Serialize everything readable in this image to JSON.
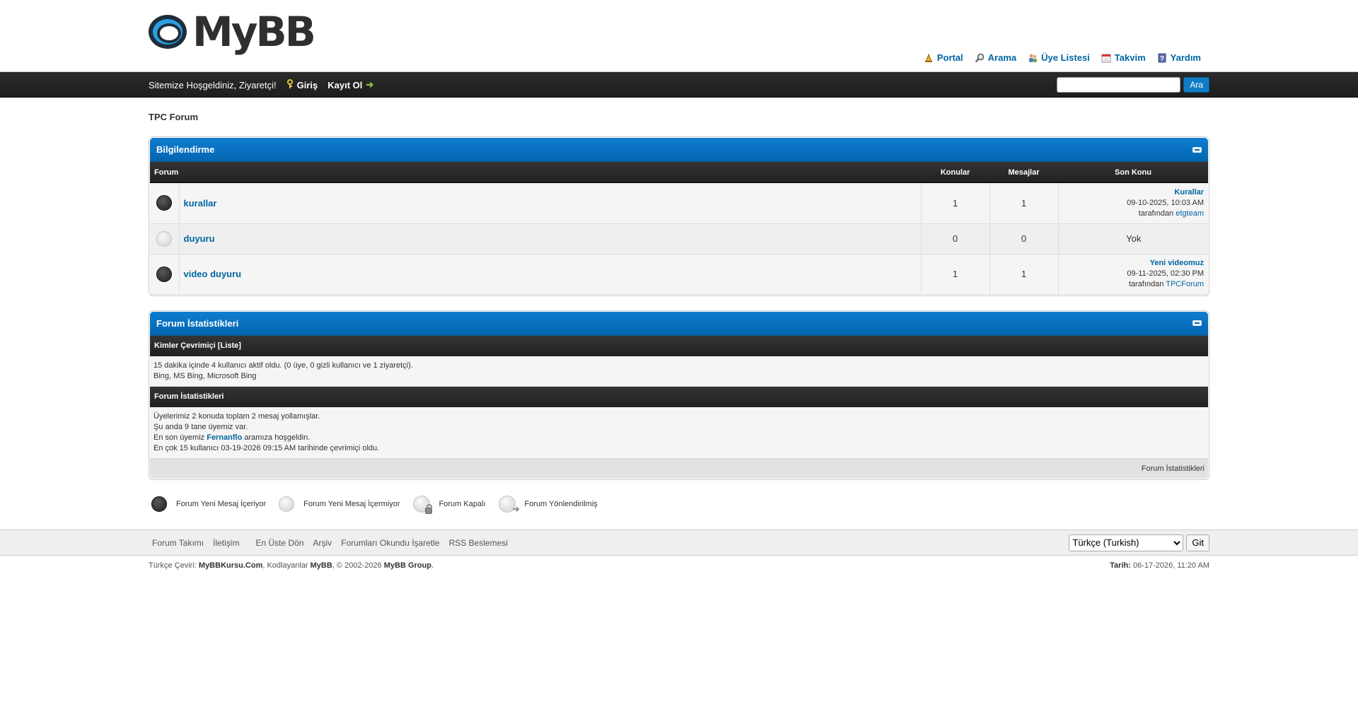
{
  "logo": {
    "text": "MyBB"
  },
  "top_menu": [
    {
      "label": "Portal",
      "icon": "portal-icon"
    },
    {
      "label": "Arama",
      "icon": "search-icon"
    },
    {
      "label": "Üye Listesi",
      "icon": "members-icon"
    },
    {
      "label": "Takvim",
      "icon": "calendar-icon"
    },
    {
      "label": "Yardım",
      "icon": "help-icon"
    }
  ],
  "panel": {
    "welcome": "Sitemize Hoşgeldiniz, Ziyaretçi!",
    "login": "Giriş",
    "register": "Kayıt Ol",
    "search_value": "",
    "search_button": "Ara"
  },
  "breadcrumb": "TPC Forum",
  "category": {
    "title": "Bilgilendirme",
    "headers": {
      "forum": "Forum",
      "threads": "Konular",
      "posts": "Mesajlar",
      "last": "Son Konu"
    },
    "forums": [
      {
        "name": "kurallar",
        "status": "on",
        "threads": "1",
        "posts": "1",
        "last_title": "Kurallar",
        "last_date": "09-10-2025, 10:03 AM",
        "by": "tarafından",
        "last_user": "etgteam"
      },
      {
        "name": "duyuru",
        "status": "off",
        "threads": "0",
        "posts": "0",
        "last_none": "Yok"
      },
      {
        "name": "video duyuru",
        "status": "on",
        "threads": "1",
        "posts": "1",
        "last_title": "Yeni videomuz",
        "last_date": "09-11-2025, 02:30 PM",
        "by": "tarafından",
        "last_user": "TPCForum"
      }
    ]
  },
  "stats": {
    "title": "Forum İstatistikleri",
    "online_head": "Kimler Çevrimiçi",
    "online_list_link": "Liste",
    "online_line1": "15 dakika içinde 4 kullanıcı aktif oldu. (0 üye, 0 gizli kullanıcı ve 1 ziyaretçi).",
    "online_line2": "Bing, MS Bing, Microsoft Bing",
    "stats_head": "Forum İstatistikleri",
    "line1": "Üyelerimiz 2 konuda toplam 2 mesaj yollamışlar.",
    "line2": "Şu anda 9 tane üyemiz var.",
    "line3_pre": "En son üyemiz",
    "line3_user": "Fernanflo",
    "line3_post": "aramıza hoşgeldin.",
    "line4": "En çok 15 kullanıcı 03-19-2026 09:15 AM tarihinde çevrimiçi oldu.",
    "footer_link": "Forum İstatistikleri"
  },
  "legend": [
    {
      "label": "Forum Yeni Mesaj İçeriyor",
      "icon": "forum-new-icon"
    },
    {
      "label": "Forum Yeni Mesaj İçermiyor",
      "icon": "forum-no-new-icon"
    },
    {
      "label": "Forum Kapalı",
      "icon": "forum-locked-icon"
    },
    {
      "label": "Forum Yönlendirilmiş",
      "icon": "forum-redirect-icon"
    }
  ],
  "footer": {
    "links": [
      "Forum Takımı",
      "İletişim",
      "En Üste Dön",
      "Arşiv",
      "Forumları Okundu İşaretle",
      "RSS Beslemesi"
    ],
    "language": "Türkçe (Turkish)",
    "go_button": "Git",
    "credit_prefix": "Türkçe Çeviri:",
    "credit_site": "MyBBKursu.Com",
    "credit_mid": ", Kodlayanlar",
    "credit_mybb": "MyBB",
    "credit_copy": ", © 2002-2026",
    "credit_group": "MyBB Group",
    "credit_end": ".",
    "date_label": "Tarih:",
    "date_value": "06-17-2026, 11:20 AM"
  },
  "colors": {
    "accent": "#0066a2",
    "thead": "#0f7dd1",
    "tcat": "#2b2b2b"
  }
}
